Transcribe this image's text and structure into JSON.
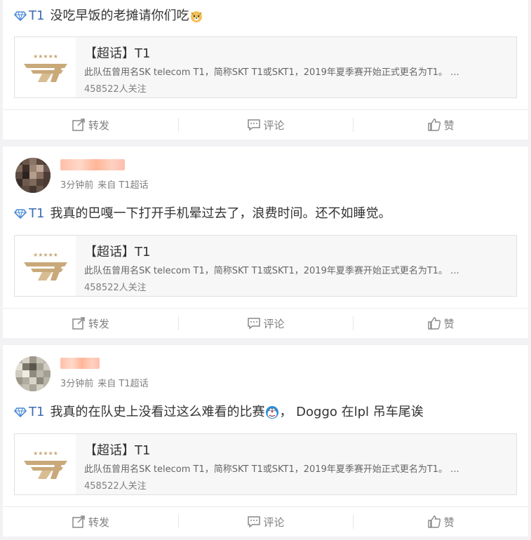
{
  "topic_label": "T1",
  "share": {
    "title": "【超话】T1",
    "description": "此队伍曾用名SK telecom T1，简称SKT T1或SKT1，2019年夏季赛开始正式更名为T1。 ...",
    "followers": "458522人关注",
    "logo_stars": "★★★★★"
  },
  "actions": {
    "repost": "转发",
    "comment": "评论",
    "like": "赞"
  },
  "posts": [
    {
      "text": "没吃早饭的老摊请你们吃",
      "emoji": "doge-face-emoji"
    },
    {
      "time": "3分钟前",
      "source": "来自 T1超话",
      "text": "我真的巴嘎一下打开手机晕过去了，浪费时间。还不如睡觉。"
    },
    {
      "time": "3分钟前",
      "source": "来自 T1超话",
      "text": "我真的在队史上没看过这么难看的比赛",
      "text_after": "， Doggo 在lpl 吊车尾诶",
      "emoji": "doraemon-emoji"
    }
  ],
  "colors": {
    "topic_blue": "#3c6cb2",
    "muted_gray": "#808080",
    "logo_gold": "#c9a97a"
  }
}
